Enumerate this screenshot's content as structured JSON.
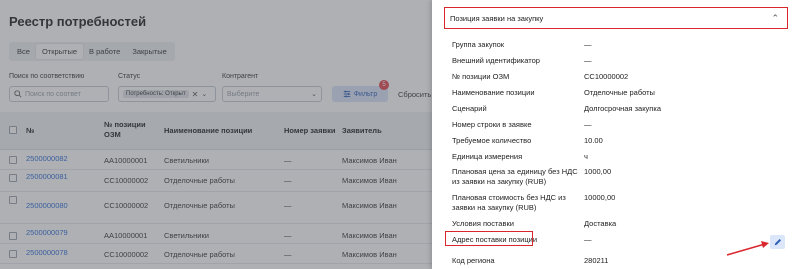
{
  "app": {
    "title": "Реестр потребностей",
    "tabs": [
      "Все",
      "Открытые",
      "В работе",
      "Закрытые"
    ],
    "active_tab": "Открытые",
    "filters": {
      "search_label": "Поиск по соответствию",
      "search_placeholder": "Поиск по соответ",
      "status_label": "Статус",
      "status_chip": "Потребность: Открыт",
      "contractor_label": "Контрагент",
      "contractor_placeholder": "Выберите",
      "filter_button": "Фильтр",
      "filter_badge": "5",
      "reset_button": "Сбросить"
    },
    "table": {
      "headers": [
        "№",
        "№ позиции ОЗМ",
        "Наименование позиции",
        "Номер заявки",
        "Заявитель"
      ],
      "rows": [
        [
          "2500000082",
          "AA10000001",
          "Светильники",
          "—",
          "Максимов Иван"
        ],
        [
          "2500000081",
          "CC10000002",
          "Отделочные работы",
          "—",
          "Максимов Иван"
        ],
        [
          "2500000080",
          "CC10000002",
          "Отделочные работы",
          "—",
          "Максимов Иван"
        ],
        [
          "2500000079",
          "AA10000001",
          "Светильники",
          "—",
          "Максимов Иван"
        ],
        [
          "2500000078",
          "CC10000002",
          "Отделочные работы",
          "—",
          "Максимов Иван"
        ]
      ]
    }
  },
  "drawer": {
    "section_title": "Позиция заявки на закупку",
    "properties": [
      {
        "label": "Группа закупок",
        "value": "—"
      },
      {
        "label": "Внешний идентификатор",
        "value": "—"
      },
      {
        "label": "№ позиции ОЗМ",
        "value": "CC10000002"
      },
      {
        "label": "Наименование позиции",
        "value": "Отделочные работы"
      },
      {
        "label": "Сценарий",
        "value": "Долгосрочная закупка"
      },
      {
        "label": "Номер строки в заявке",
        "value": "—"
      },
      {
        "label": "Требуемое количество",
        "value": "10.00"
      },
      {
        "label": "Единица измерения",
        "value": "ч"
      },
      {
        "label": "Плановая цена за единицу без НДС из заявки на закупку (RUB)",
        "value": "1000,00"
      },
      {
        "label": "Плановая стоимость без НДС из заявки на закупку (RUB)",
        "value": "10000,00"
      },
      {
        "label": "Условия поставки",
        "value": "Доставка"
      },
      {
        "label": "Адрес поставки позиции",
        "value": "—"
      },
      {
        "label": "Код региона",
        "value": "280211"
      }
    ]
  },
  "colors": {
    "accent": "#2e6bd6",
    "highlight": "#d9262c",
    "badge": "#e5484d"
  }
}
